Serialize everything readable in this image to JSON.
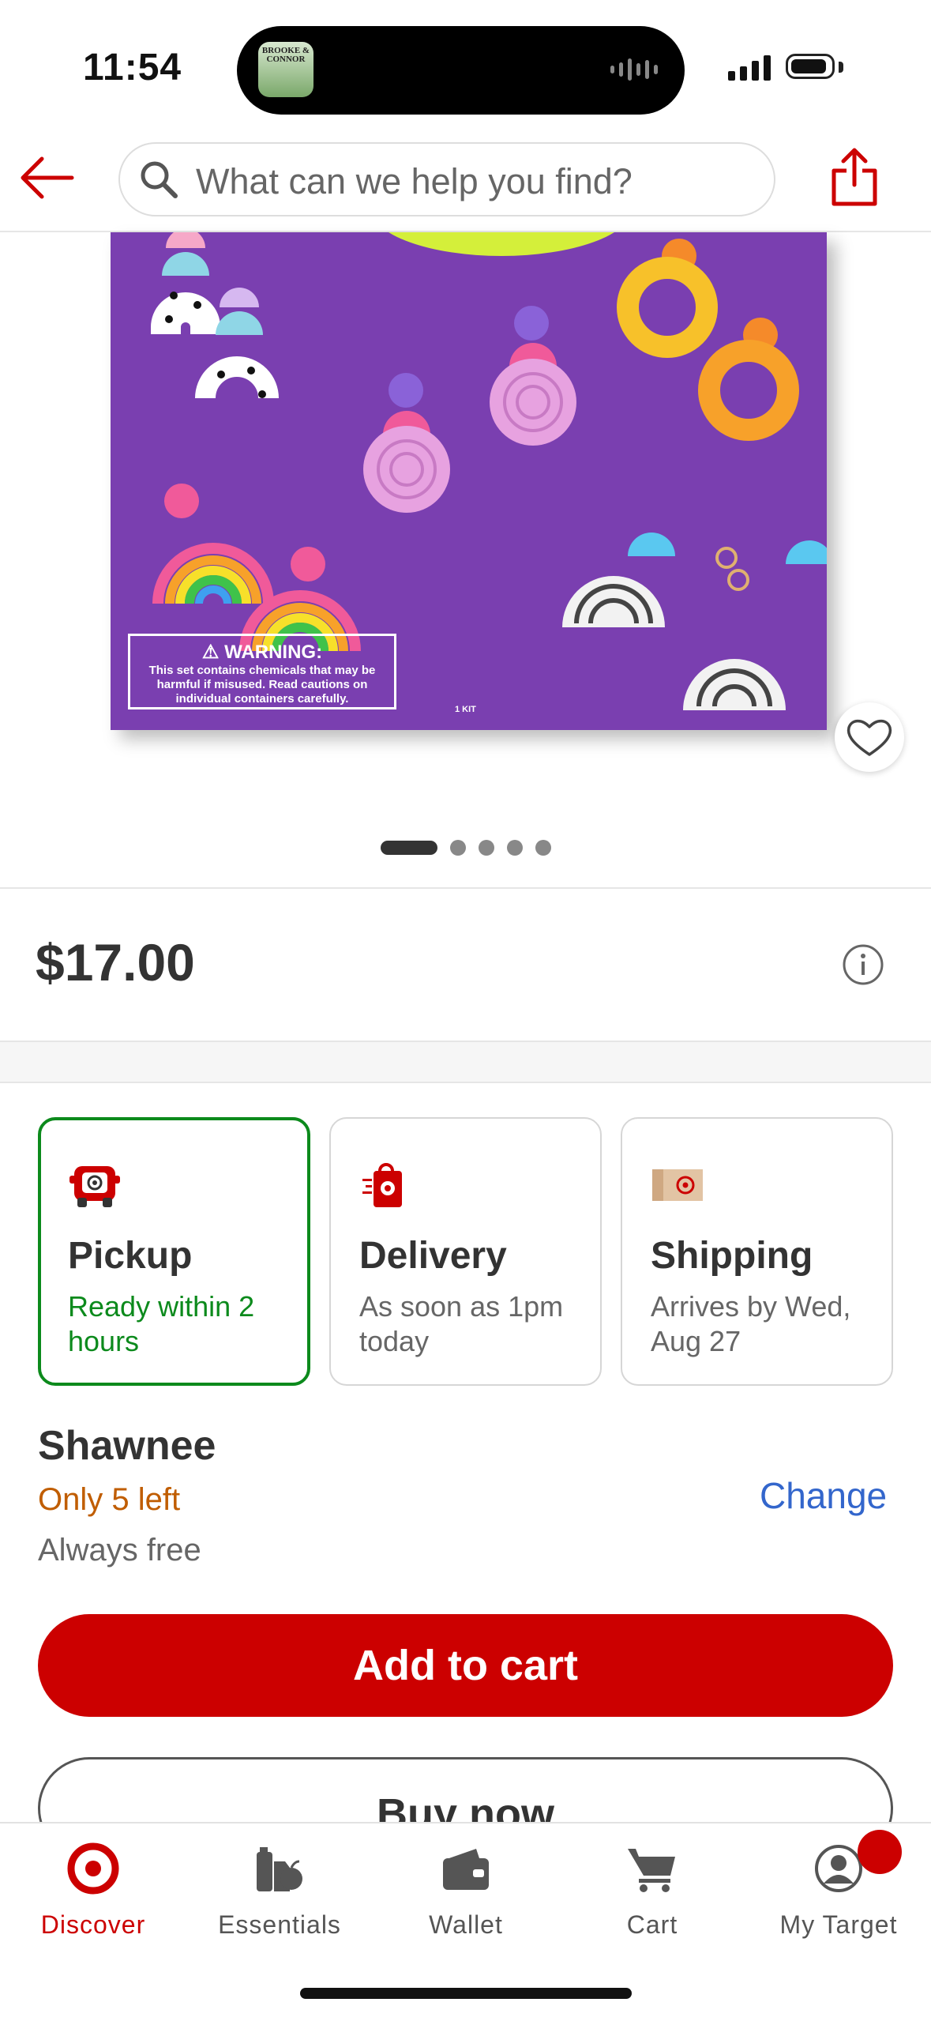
{
  "status_bar": {
    "time": "11:54",
    "island_art_text": "BROOKE & CONNOR"
  },
  "header": {
    "search_placeholder": "What can we help you find?"
  },
  "product_image": {
    "warning_title": "WARNING:",
    "warning_body": "This set contains chemicals that may be harmful if misused. Read cautions on individual containers carefully.",
    "kit_label": "1 KIT",
    "carousel_count": 5,
    "carousel_active": 1
  },
  "price": "$17.00",
  "fulfillment": [
    {
      "title": "Pickup",
      "subtitle": "Ready within 2 hours",
      "icon": "pickup-car-icon",
      "selected": true
    },
    {
      "title": "Delivery",
      "subtitle": "As soon as 1pm today",
      "icon": "delivery-bag-icon",
      "selected": false
    },
    {
      "title": "Shipping",
      "subtitle": "Arrives by Wed, Aug 27",
      "icon": "shipping-box-icon",
      "selected": false
    }
  ],
  "store": {
    "name": "Shawnee",
    "stock": "Only 5 left",
    "cost": "Always free",
    "change_label": "Change"
  },
  "actions": {
    "add_to_cart": "Add to cart",
    "buy_now": "Buy now"
  },
  "tabs": [
    {
      "label": "Discover",
      "icon": "target-logo-icon",
      "active": true
    },
    {
      "label": "Essentials",
      "icon": "essentials-icon",
      "active": false
    },
    {
      "label": "Wallet",
      "icon": "wallet-icon",
      "active": false
    },
    {
      "label": "Cart",
      "icon": "cart-icon",
      "active": false
    },
    {
      "label": "My Target",
      "icon": "account-icon",
      "active": false
    }
  ],
  "colors": {
    "brand_red": "#cc0000",
    "pickup_green": "#0c8a1c",
    "stock_orange": "#c05d00",
    "link_blue": "#3366cc"
  }
}
